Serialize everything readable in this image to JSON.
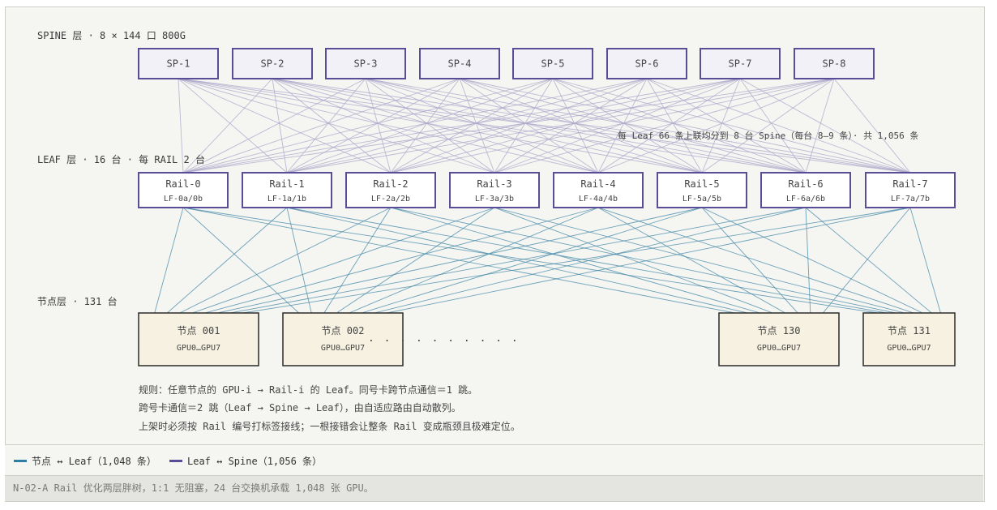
{
  "spine_layer": {
    "label": "SPINE 层 · 8 × 144 口 800G",
    "switches": [
      "SP-1",
      "SP-2",
      "SP-3",
      "SP-4",
      "SP-5",
      "SP-6",
      "SP-7",
      "SP-8"
    ]
  },
  "leaf_layer": {
    "label": "LEAF 层 · 16 台 · 每 RAIL 2 台",
    "uplink_note": "每 Leaf 66 条上联均分到 8 台 Spine（每台 8–9 条）· 共 1,056 条",
    "rails": [
      {
        "name": "Rail-0",
        "leafs": "LF-0a/0b"
      },
      {
        "name": "Rail-1",
        "leafs": "LF-1a/1b"
      },
      {
        "name": "Rail-2",
        "leafs": "LF-2a/2b"
      },
      {
        "name": "Rail-3",
        "leafs": "LF-3a/3b"
      },
      {
        "name": "Rail-4",
        "leafs": "LF-4a/4b"
      },
      {
        "name": "Rail-5",
        "leafs": "LF-5a/5b"
      },
      {
        "name": "Rail-6",
        "leafs": "LF-6a/6b"
      },
      {
        "name": "Rail-7",
        "leafs": "LF-7a/7b"
      }
    ]
  },
  "node_layer": {
    "label": "节点层 · 131 台",
    "nodes": [
      {
        "name": "节点 001",
        "gpus": "GPU0…GPU7"
      },
      {
        "name": "节点 002",
        "gpus": "GPU0…GPU7"
      },
      {
        "name": "节点 130",
        "gpus": "GPU0…GPU7"
      },
      {
        "name": "节点 131",
        "gpus": "GPU0…GPU7"
      }
    ],
    "ellipsis": ". . . . . . . . . ."
  },
  "rules": [
    "规则：任意节点的 GPU-i → Rail-i 的 Leaf。同号卡跨节点通信＝1 跳。",
    "跨号卡通信＝2 跳（Leaf → Spine → Leaf），由自适应路由自动散列。",
    "上架时必须按 Rail 编号打标签接线；一根接错会让整条 Rail 变成瓶颈且极难定位。"
  ],
  "legend": {
    "node_leaf": "节点 ↔ Leaf（1,048 条）",
    "leaf_spine": "Leaf ↔ Spine（1,056 条）"
  },
  "caption": "N-02-A Rail 优化两层胖树，1:1 无阻塞，24 台交换机承载 1,048 张 GPU。",
  "colors": {
    "node_leaf_line": "#3f86a6",
    "leaf_spine_line": "#5a4c96",
    "node_fill": "#f6f1e0",
    "switch_border": "#5a4c96"
  }
}
